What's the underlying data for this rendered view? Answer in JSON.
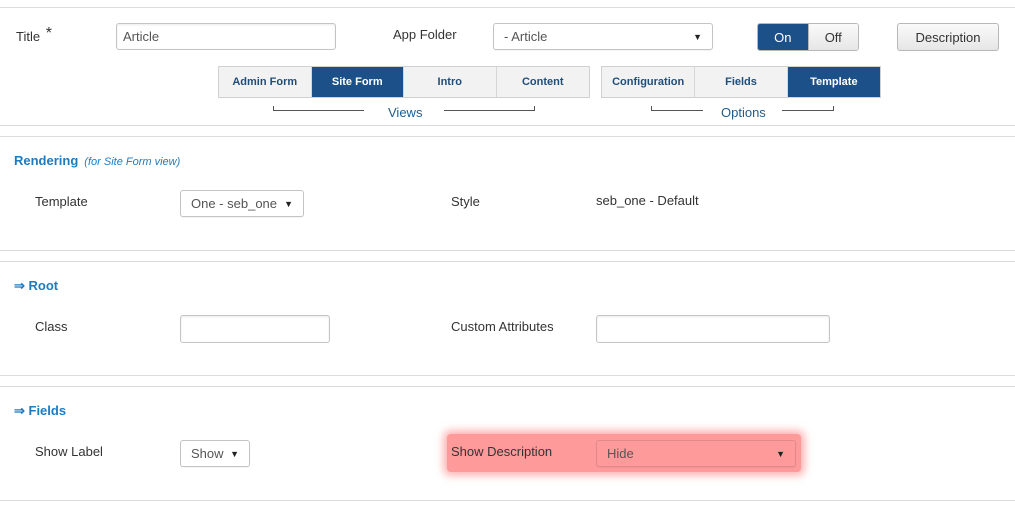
{
  "header": {
    "title_label": "Title",
    "required_mark": "*",
    "title_value": "Article",
    "app_folder_label": "App Folder",
    "app_folder_value": "- Article",
    "toggle_on": "On",
    "toggle_off": "Off",
    "description_button": "Description"
  },
  "views": {
    "tabs": [
      "Admin Form",
      "Site Form",
      "Intro",
      "Content"
    ],
    "active": "Site Form",
    "group_label": "Views"
  },
  "options": {
    "tabs": [
      "Configuration",
      "Fields",
      "Template"
    ],
    "active": "Template",
    "group_label": "Options"
  },
  "rendering": {
    "title": "Rendering",
    "subtitle": "(for Site Form view)",
    "template_label": "Template",
    "template_value": "One - seb_one",
    "style_label": "Style",
    "style_value": "seb_one - Default"
  },
  "root": {
    "title": "⇒ Root",
    "class_label": "Class",
    "class_value": "",
    "custom_attributes_label": "Custom Attributes",
    "custom_attributes_value": ""
  },
  "fields": {
    "title": "⇒ Fields",
    "show_label_label": "Show Label",
    "show_label_value": "Show",
    "show_description_label": "Show Description",
    "show_description_value": "Hide"
  },
  "colors": {
    "accent_blue": "#1c5088",
    "section_blue": "#1e7bbf",
    "highlight_red": "#ff9a9a"
  }
}
